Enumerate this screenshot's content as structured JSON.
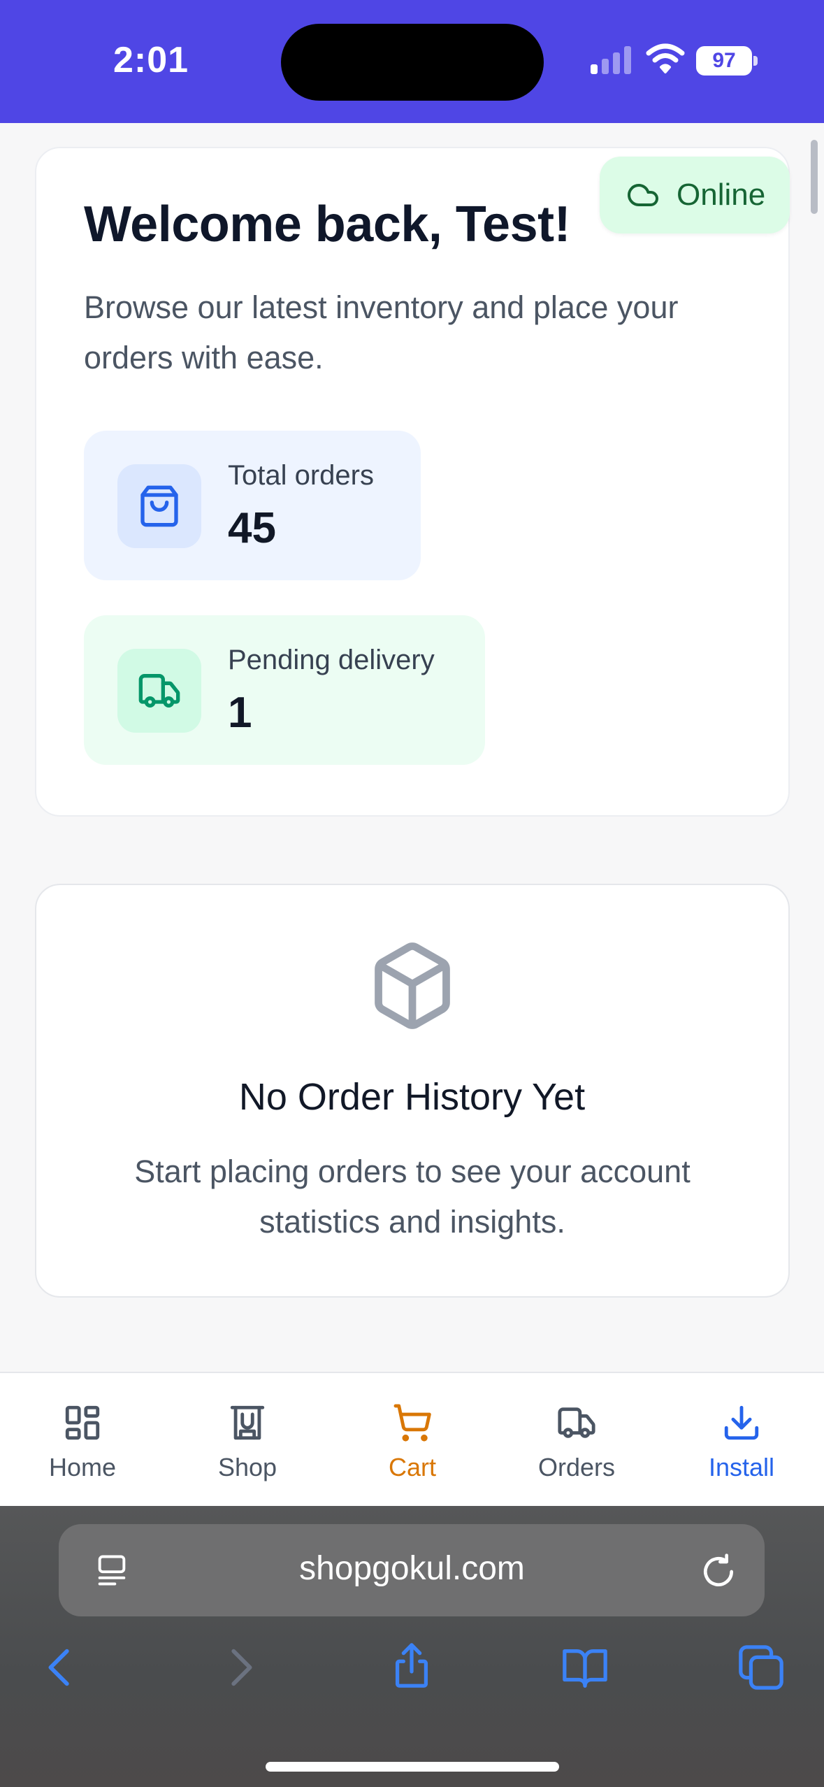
{
  "status_bar": {
    "time": "2:01",
    "battery": "97"
  },
  "online_badge": {
    "label": "Online",
    "icon": "cloud-icon"
  },
  "welcome": {
    "title": "Welcome back, Test!",
    "subtitle": "Browse our latest inventory and place your orders with ease."
  },
  "stats": [
    {
      "label": "Total orders",
      "value": "45",
      "icon": "shopping-bag-icon",
      "accent": "#2563eb"
    },
    {
      "label": "Pending delivery",
      "value": "1",
      "icon": "truck-icon",
      "accent": "#059669"
    }
  ],
  "empty_state": {
    "icon": "package-icon",
    "title": "No Order History Yet",
    "message": "Start placing orders to see your account statistics and insights."
  },
  "bottom_nav": {
    "items": [
      {
        "label": "Home",
        "icon": "grid-icon"
      },
      {
        "label": "Shop",
        "icon": "store-icon"
      },
      {
        "label": "Cart",
        "icon": "cart-icon",
        "active": true
      },
      {
        "label": "Orders",
        "icon": "truck-icon"
      },
      {
        "label": "Install",
        "icon": "download-icon"
      }
    ]
  },
  "browser": {
    "url": "shopgokul.com"
  },
  "colors": {
    "header": "#4f46e5",
    "active_nav": "#d97706",
    "install": "#2563eb",
    "online": "#166534"
  }
}
